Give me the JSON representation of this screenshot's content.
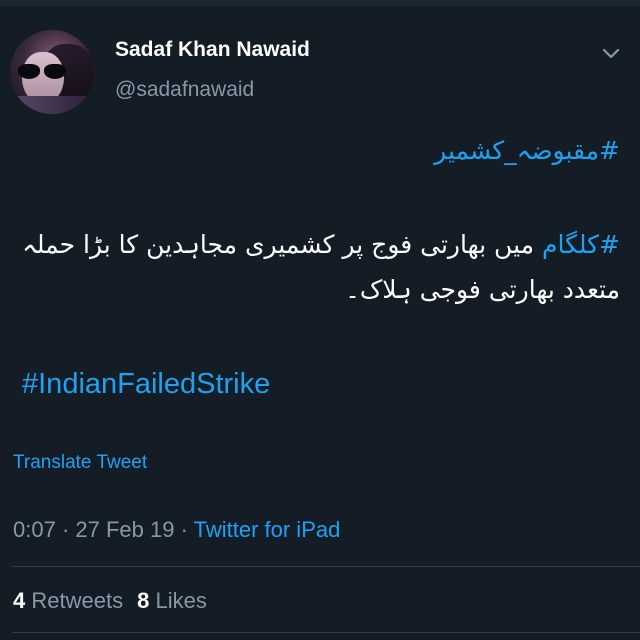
{
  "tweet": {
    "author": {
      "display_name": "Sadaf Khan Nawaid",
      "handle": "@sadafnawaid",
      "avatar_icon": "user-avatar-photo"
    },
    "menu_icon": "chevron-down-icon",
    "hashtag_kashmir": "#مقبوضہ_کشمیر",
    "body": {
      "hashtag": "#کلگام",
      "text": " میں بھارتی فوج پر کشمیری مجاہدین کا بڑا حملہ متعدد بھارتی فوجی ہلاک۔"
    },
    "hashtag_en": "#IndianFailedStrike",
    "translate_label": "Translate Tweet",
    "time": "0:07",
    "date": "27 Feb 19",
    "separator": " · ",
    "source": "Twitter for iPad",
    "retweets_count": "4",
    "retweets_label": "Retweets",
    "likes_count": "8",
    "likes_label": "Likes"
  },
  "colors": {
    "background": "#141d26",
    "link": "#1da1f2",
    "muted": "#8899a6",
    "text": "#ffffff",
    "divider": "#2f3d4a"
  }
}
